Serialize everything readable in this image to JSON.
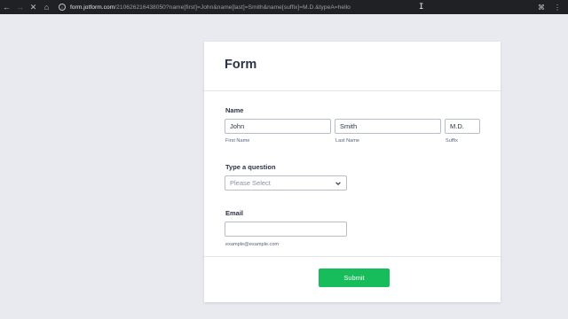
{
  "browser": {
    "back_icon": "arrow-left-icon",
    "forward_icon": "arrow-right-icon",
    "stop_icon": "close-icon",
    "home_icon": "home-icon",
    "url_host": "form.jotform.com",
    "url_rest": "/210626216438050?name[first]=John&name[last]=Smith&name[suffix]=M.D.&typeA=hello"
  },
  "form": {
    "title": "Form",
    "name_label": "Name",
    "first_name_value": "John",
    "last_name_value": "Smith",
    "suffix_value": "M.D.",
    "first_name_sublabel": "First Name",
    "last_name_sublabel": "Last Name",
    "suffix_sublabel": "Suffix",
    "question_label": "Type a question",
    "select_placeholder": "Please Select",
    "email_label": "Email",
    "email_value": "",
    "email_sublabel": "example@example.com",
    "submit_label": "Submit"
  },
  "colors": {
    "page_bg": "#e9eaef",
    "submit_green": "#18bd5b",
    "text_dark": "#2c3345"
  }
}
